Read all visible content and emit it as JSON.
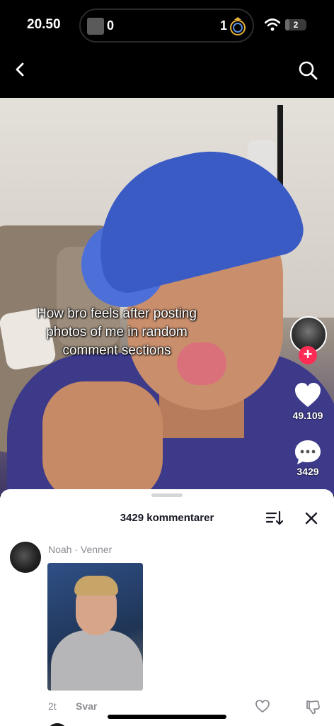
{
  "status_bar": {
    "time": "20.50",
    "score_left": "0",
    "score_right": "1",
    "battery_level": "2",
    "battery_fraction": 0.2,
    "icons": {
      "wifi": "wifi-icon",
      "team_right": "team-crest-icon"
    }
  },
  "nav": {
    "back_icon": "chevron-left-icon",
    "search_icon": "search-icon"
  },
  "video": {
    "caption": "How bro feels after posting photos of me in random comment sections",
    "likes": "49.109",
    "comments": "3429",
    "follow_label": "+"
  },
  "comments_sheet": {
    "title": "3429 kommentarer",
    "comment": {
      "header": "Noah · Venner",
      "time": "2t",
      "reply_label": "Svar"
    }
  },
  "colors": {
    "accent": "#fe2c55",
    "sheet_text": "#161823",
    "muted_text": "#8a8b91"
  }
}
